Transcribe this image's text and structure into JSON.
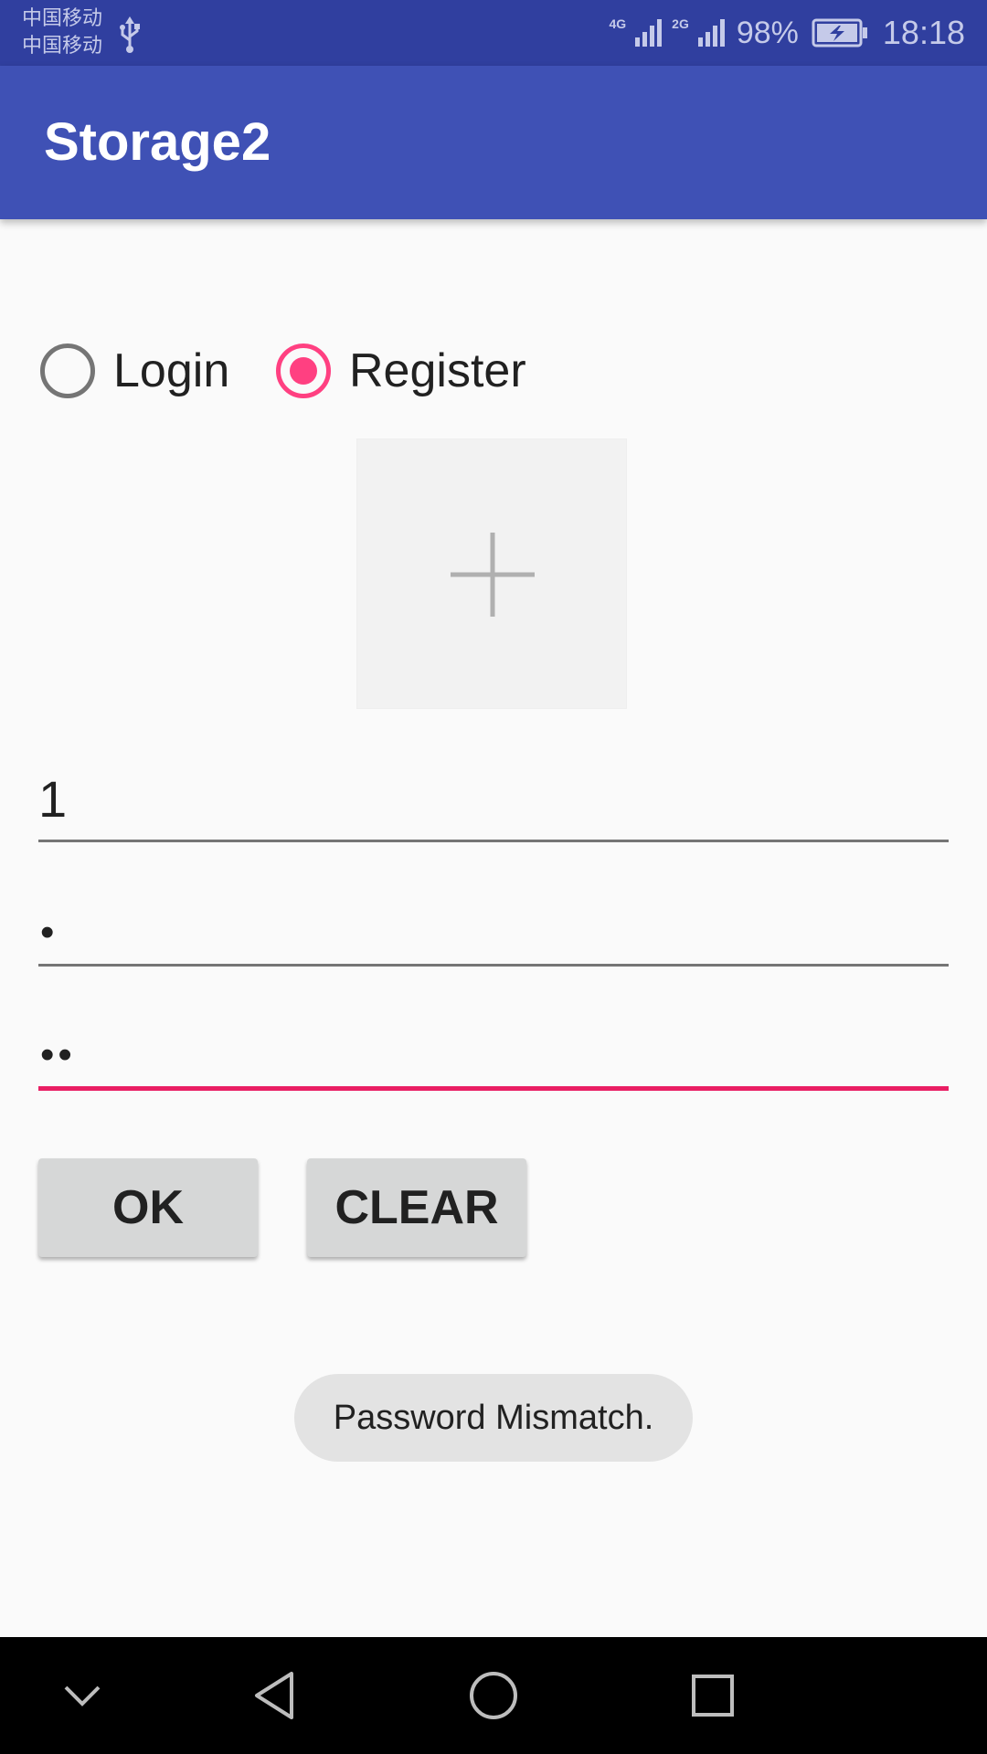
{
  "status_bar": {
    "carrier_1": "中国移动",
    "carrier_2": "中国移动",
    "network_1": "4G",
    "network_2": "2G",
    "battery": "98%",
    "time": "18:18"
  },
  "app_bar": {
    "title": "Storage2"
  },
  "mode": {
    "options": [
      {
        "label": "Login",
        "checked": false
      },
      {
        "label": "Register",
        "checked": true
      }
    ]
  },
  "avatar_picker": {
    "icon": "plus-icon"
  },
  "form": {
    "username_value": "1",
    "password_dots": "•",
    "confirm_dots": "••"
  },
  "buttons": {
    "ok": "OK",
    "clear": "CLEAR"
  },
  "toast": {
    "message": "Password Mismatch."
  },
  "nav": {
    "icons": [
      "chevron-down-icon",
      "back-icon",
      "home-icon",
      "recents-icon"
    ]
  },
  "colors": {
    "primary": "#3f51b5",
    "primary_dark": "#303f9f",
    "accent": "#ff4081",
    "focus_underline": "#e91e63"
  }
}
